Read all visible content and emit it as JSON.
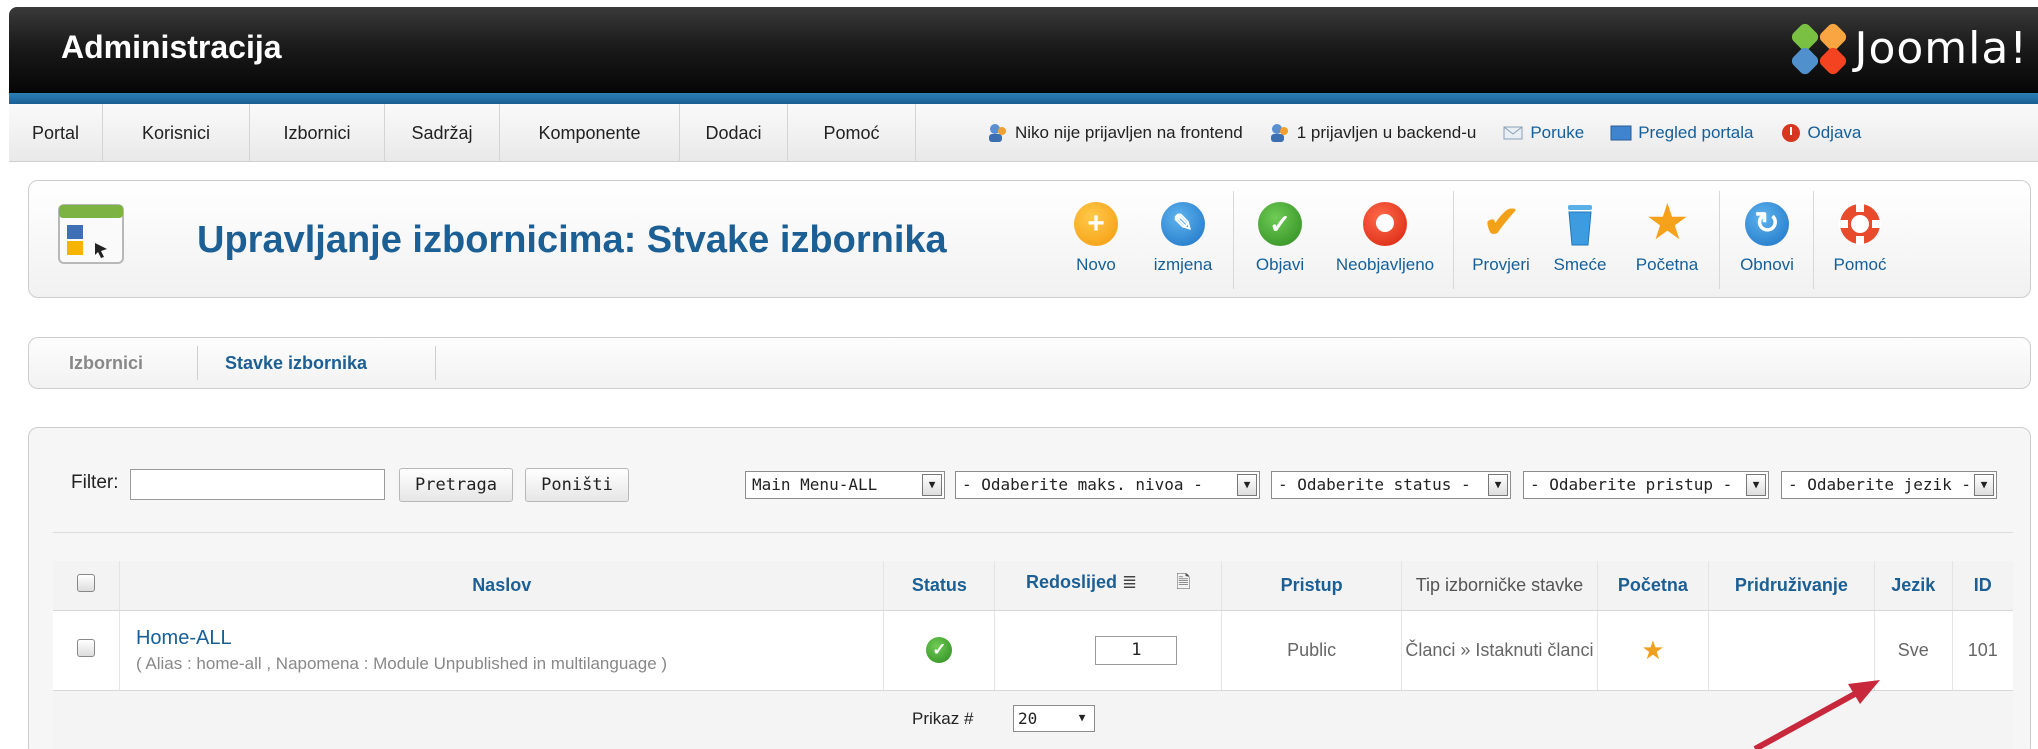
{
  "header": {
    "title": "Administracija",
    "logo_text": "Joomla!"
  },
  "menu": [
    "Portal",
    "Korisnici",
    "Izbornici",
    "Sadržaj",
    "Komponente",
    "Dodaci",
    "Pomoć"
  ],
  "status": {
    "frontend": "Niko nije prijavljen na frontend",
    "backend": "1 prijavljen u backend-u",
    "messages": "Poruke",
    "preview": "Pregled portala",
    "logout": "Odjava"
  },
  "toolbar": {
    "title": "Upravljanje izbornicima: Stvake izbornika",
    "buttons": {
      "new": "Novo",
      "edit": "izmjena",
      "publish": "Objavi",
      "unpublish": "Neobjavljeno",
      "checkin": "Provjeri",
      "trash": "Smeće",
      "home": "Početna",
      "refresh": "Obnovi",
      "help": "Pomoć"
    }
  },
  "tabs": [
    "Izbornici",
    "Stavke izbornika"
  ],
  "filter": {
    "label": "Filter:",
    "value": "",
    "search_button": "Pretraga",
    "reset_button": "Poništi",
    "selects": [
      "Main Menu-ALL",
      "- Odaberite maks. nivoa -",
      "- Odaberite status -",
      "- Odaberite pristup -",
      "- Odaberite jezik -"
    ]
  },
  "table": {
    "headers": {
      "title": "Naslov",
      "status": "Status",
      "order": "Redoslijed",
      "access": "Pristup",
      "type": "Tip izborničke stavke",
      "home": "Početna",
      "association": "Pridruživanje",
      "language": "Jezik",
      "id": "ID"
    },
    "rows": [
      {
        "title": "Home-ALL",
        "subtitle": "( Alias : home-all , Napomena : Module Unpublished in multilanguage )",
        "order": "1",
        "access": "Public",
        "type": "Članci » Istaknuti članci",
        "language": "Sve",
        "id": "101"
      }
    ]
  },
  "pager": {
    "label": "Prikaz #",
    "value": "20"
  },
  "colors": {
    "accent": "#1c5f94",
    "annotation_arrow": "#c8283c"
  }
}
